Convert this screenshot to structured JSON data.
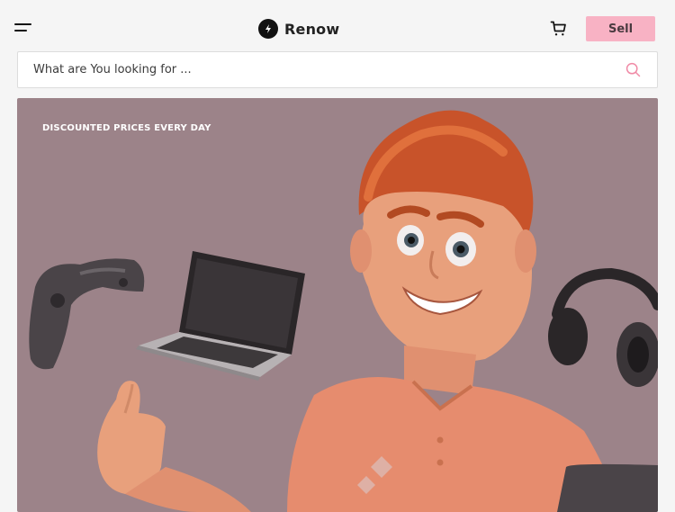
{
  "header": {
    "logo_text": "Renow",
    "sell_label": "Sell",
    "menu_icon": "hamburger-menu-icon",
    "cart_icon": "shopping-cart-icon"
  },
  "search": {
    "placeholder": "What are You looking for ...",
    "icon": "search-icon"
  },
  "hero": {
    "tagline": "DISCOUNTED PRICES EVERY DAY"
  },
  "colors": {
    "accent": "#f8b2c4",
    "hero_bg": "#9c8389",
    "page_bg": "#f5f5f5"
  }
}
